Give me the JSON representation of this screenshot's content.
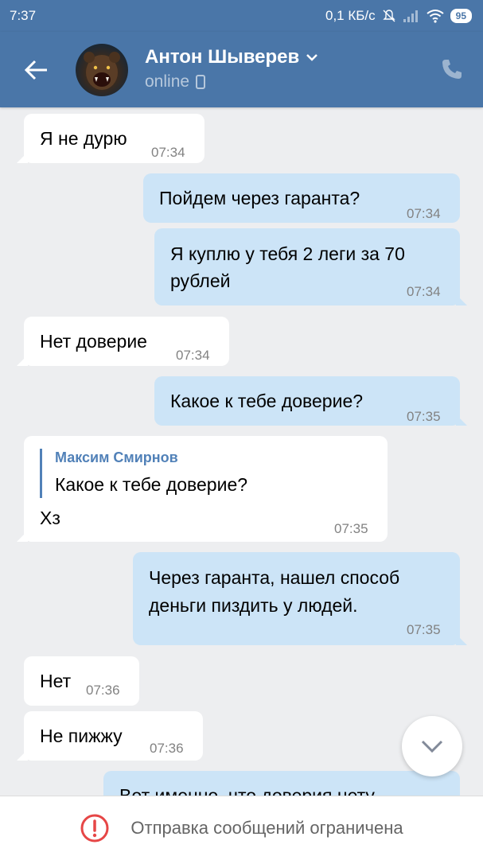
{
  "status_bar": {
    "time": "7:37",
    "speed": "0,1 КБ/с",
    "battery": "95",
    "icons": [
      "bell-off-icon",
      "signal-icon",
      "wifi-icon",
      "battery-icon"
    ]
  },
  "header": {
    "name": "Антон Шыверев",
    "status": "online",
    "icons": [
      "back-arrow-icon",
      "chevron-down-icon",
      "mobile-icon",
      "phone-icon"
    ]
  },
  "messages": [
    {
      "dir": "in",
      "text": "Я не дурю",
      "time": "07:34"
    },
    {
      "dir": "out",
      "text": "Пойдем через гаранта?",
      "time": "07:34"
    },
    {
      "dir": "out",
      "text_lines": [
        "Я куплю у тебя 2 леги за 70",
        "рублей"
      ],
      "time": "07:34"
    },
    {
      "dir": "in",
      "text": "Нет доверие",
      "time": "07:34"
    },
    {
      "dir": "out",
      "text": "Какое к тебе доверие?",
      "time": "07:35"
    },
    {
      "dir": "in",
      "reply": {
        "author": "Максим Смирнов",
        "text": "Какое к тебе доверие?"
      },
      "text": "Хз",
      "time": "07:35"
    },
    {
      "dir": "out",
      "text_lines": [
        "Через гаранта, нашел способ",
        "деньги пиздить у людей."
      ],
      "time": "07:35"
    },
    {
      "dir": "in",
      "text": "Нет",
      "time": "07:36"
    },
    {
      "dir": "in",
      "text": "Не пижжу",
      "time": "07:36"
    },
    {
      "dir": "out",
      "text": "Вот именно, что доверия нету"
    }
  ],
  "footer": {
    "notice": "Отправка сообщений ограничена",
    "icon": "alert-circle-icon",
    "accent_color": "#e64646"
  },
  "colors": {
    "header": "#4a76a8",
    "background": "#edeef0",
    "outgoing_bubble": "#cce4f7",
    "incoming_bubble": "#ffffff",
    "time_text": "#828282",
    "reply_accent": "#5181b8"
  }
}
